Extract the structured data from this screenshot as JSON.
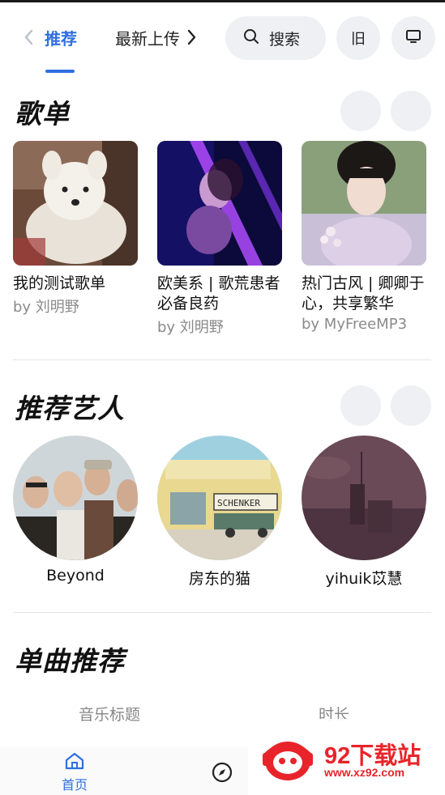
{
  "header": {
    "tabs": [
      "推荐",
      "最新上传"
    ],
    "search_label": "搜索",
    "old_label": "旧",
    "icons": [
      "chevron-left-icon",
      "chevron-right-icon",
      "search-icon",
      "monitor-icon"
    ]
  },
  "sections": {
    "playlists_title": "歌单",
    "artists_title": "推荐艺人",
    "songs_title": "单曲推荐"
  },
  "playlists": [
    {
      "title": "我的测试歌单",
      "by": "by 刘明野"
    },
    {
      "title": "欧美系 | 歌荒患者必备良药",
      "by": "by 刘明野"
    },
    {
      "title": "热门古风 | 卿卿于心，共享繁华",
      "by": "by MyFreeMP3"
    }
  ],
  "artists": [
    {
      "name": "Beyond"
    },
    {
      "name": "房东的猫"
    },
    {
      "name": "yihuik苡慧"
    }
  ],
  "songs_table": {
    "columns": [
      "音乐标题",
      "时长"
    ]
  },
  "bottom_nav": {
    "home_label": "首页"
  },
  "watermark": {
    "title": "92下载站",
    "url": "www.xz92.com"
  },
  "colors": {
    "accent": "#2f6fe0",
    "muted": "#8a8a8a",
    "button_bg": "#eef0f3",
    "watermark": "#e8242a"
  }
}
